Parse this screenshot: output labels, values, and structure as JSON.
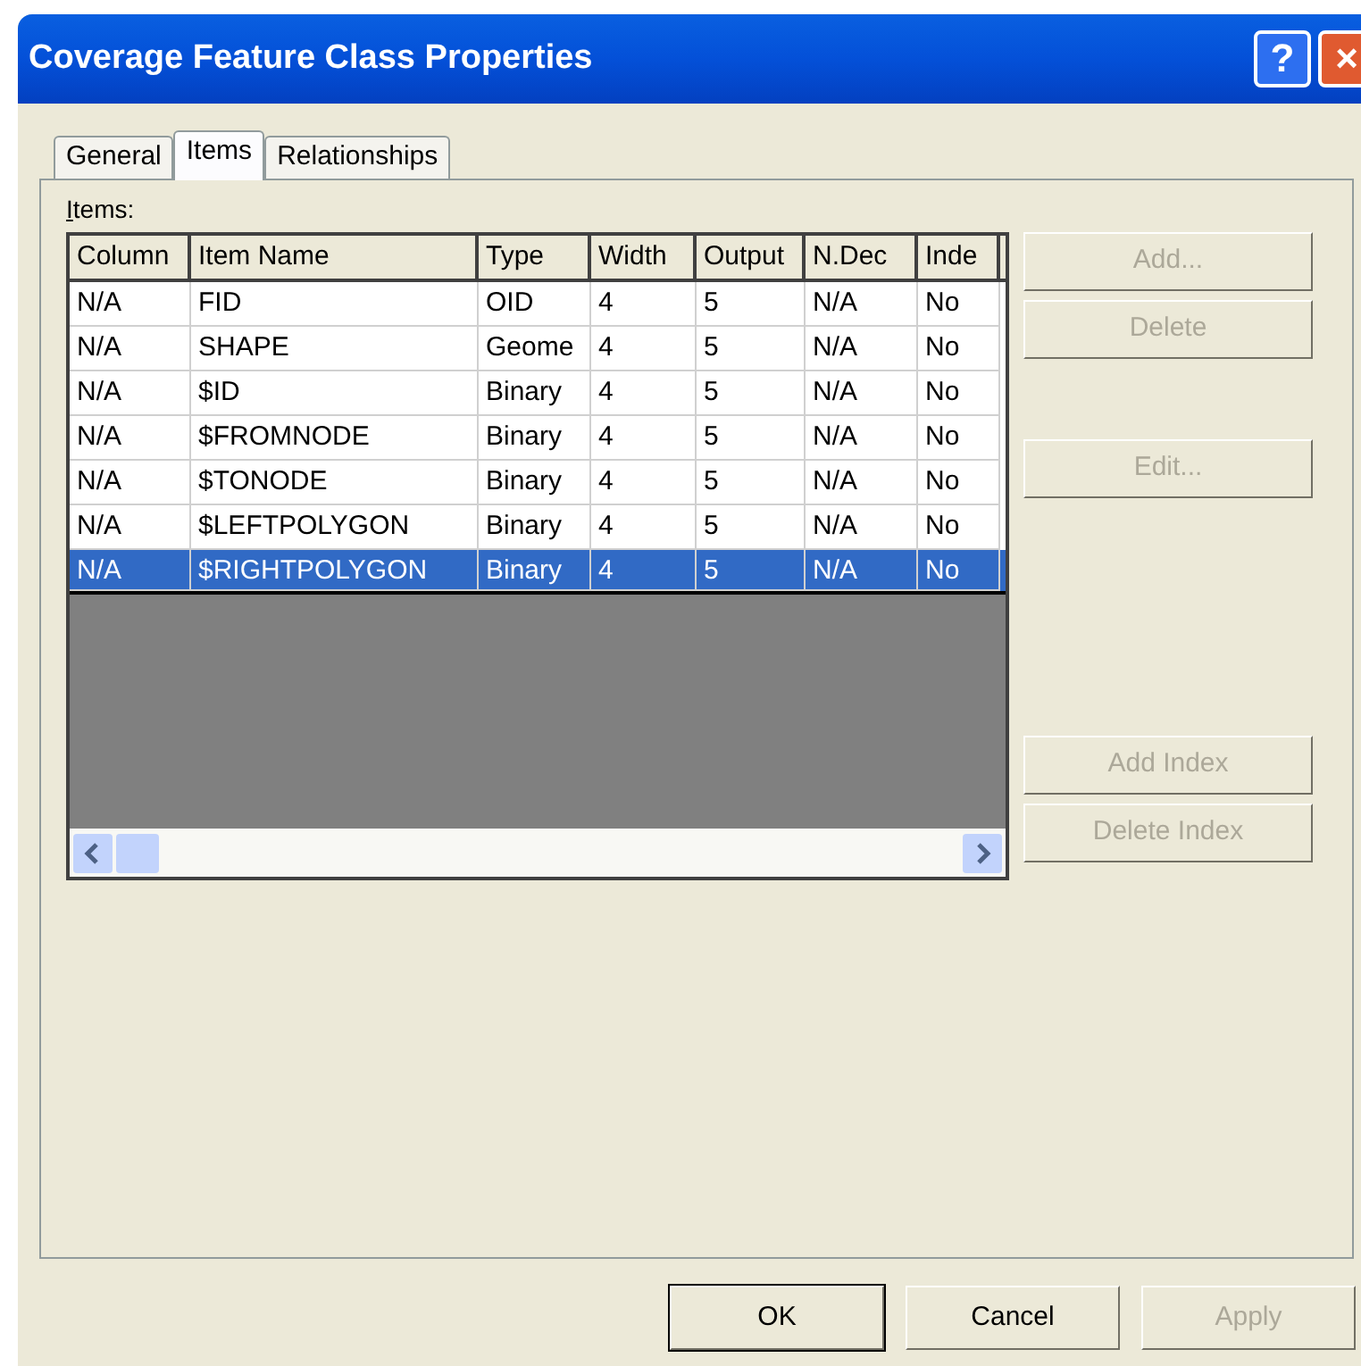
{
  "window": {
    "title": "Coverage Feature Class Properties"
  },
  "title_buttons": [
    {
      "label": "?",
      "kind": "help"
    },
    {
      "label": "×",
      "kind": "close"
    }
  ],
  "tabs": [
    {
      "label": "General",
      "selected": false
    },
    {
      "label": "Items",
      "selected": true
    },
    {
      "label": "Relationships",
      "selected": false
    }
  ],
  "items_label": "Items:",
  "table": {
    "columns": [
      "Column",
      "Item Name",
      "Type",
      "Width",
      "Output",
      "N.Dec",
      "Inde"
    ],
    "rows": [
      {
        "cells": [
          "N/A",
          "FID",
          "OID",
          "4",
          "5",
          "N/A",
          "No"
        ],
        "selected": false
      },
      {
        "cells": [
          "N/A",
          "SHAPE",
          "Geome",
          "4",
          "5",
          "N/A",
          "No"
        ],
        "selected": false
      },
      {
        "cells": [
          "N/A",
          "$ID",
          "Binary",
          "4",
          "5",
          "N/A",
          "No"
        ],
        "selected": false
      },
      {
        "cells": [
          "N/A",
          "$FROMNODE",
          "Binary",
          "4",
          "5",
          "N/A",
          "No"
        ],
        "selected": false
      },
      {
        "cells": [
          "N/A",
          "$TONODE",
          "Binary",
          "4",
          "5",
          "N/A",
          "No"
        ],
        "selected": false
      },
      {
        "cells": [
          "N/A",
          "$LEFTPOLYGON",
          "Binary",
          "4",
          "5",
          "N/A",
          "No"
        ],
        "selected": false
      },
      {
        "cells": [
          "N/A",
          "$RIGHTPOLYGON",
          "Binary",
          "4",
          "5",
          "N/A",
          "No"
        ],
        "selected": true
      }
    ]
  },
  "side_buttons": [
    {
      "label": "Add...",
      "disabled": true,
      "gap_before": false
    },
    {
      "label": "Delete",
      "disabled": true,
      "gap_before": false
    },
    {
      "label": "Edit...",
      "disabled": true,
      "gap_before": true
    },
    {
      "label": "Add Index",
      "disabled": true,
      "gap_before": true
    },
    {
      "label": "Delete Index",
      "disabled": true,
      "gap_before": false
    }
  ],
  "footer_buttons": [
    {
      "label": "OK",
      "disabled": false,
      "default": true
    },
    {
      "label": "Cancel",
      "disabled": false,
      "default": false
    },
    {
      "label": "Apply",
      "disabled": true,
      "default": false
    }
  ]
}
